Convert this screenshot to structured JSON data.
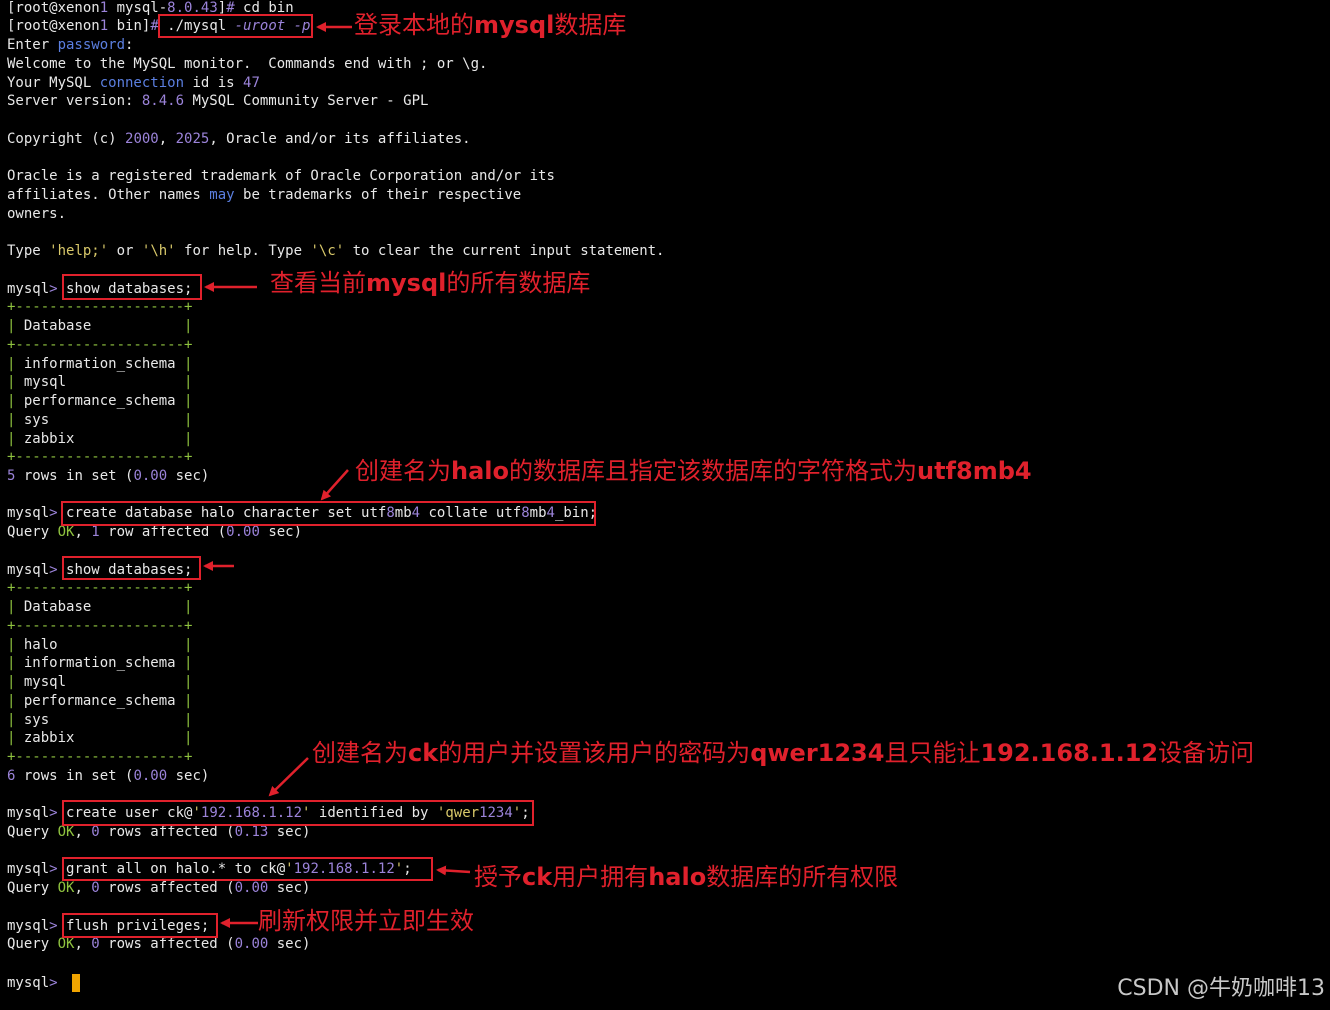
{
  "terminal": {
    "lines": [
      "[root@xenon1 mysql-8.0.43]# cd bin",
      "[root@xenon1 bin]# ./mysql -uroot -p",
      "Enter password:",
      "Welcome to the MySQL monitor.  Commands end with ; or \\g.",
      "Your MySQL connection id is 47",
      "Server version: 8.4.6 MySQL Community Server - GPL",
      "",
      "Copyright (c) 2000, 2025, Oracle and/or its affiliates.",
      "",
      "Oracle is a registered trademark of Oracle Corporation and/or its",
      "affiliates. Other names may be trademarks of their respective",
      "owners.",
      "",
      "Type 'help;' or '\\h' for help. Type '\\c' to clear the current input statement.",
      "",
      "mysql> show databases;",
      "+--------------------+",
      "| Database           |",
      "+--------------------+",
      "| information_schema |",
      "| mysql              |",
      "| performance_schema |",
      "| sys                |",
      "| zabbix             |",
      "+--------------------+",
      "5 rows in set (0.00 sec)",
      "",
      "mysql> create database halo character set utf8mb4 collate utf8mb4_bin;",
      "Query OK, 1 row affected (0.00 sec)",
      "",
      "mysql> show databases;",
      "+--------------------+",
      "| Database           |",
      "+--------------------+",
      "| halo               |",
      "| information_schema |",
      "| mysql              |",
      "| performance_schema |",
      "| sys                |",
      "| zabbix             |",
      "+--------------------+",
      "6 rows in set (0.00 sec)",
      "",
      "mysql> create user ck@'192.168.1.12' identified by 'qwer1234';",
      "Query OK, 0 rows affected (0.13 sec)",
      "",
      "mysql> grant all on halo.* to ck@'192.168.1.12';",
      "Query OK, 0 rows affected (0.00 sec)",
      "",
      "mysql> flush privileges;",
      "Query OK, 0 rows affected (0.00 sec)",
      "",
      "mysql> "
    ]
  },
  "annotations": {
    "login": "登录本地的mysql数据库",
    "show_all": "查看当前mysql的所有数据库",
    "create_db": "创建名为halo的数据库且指定该数据库的字符格式为utf8mb4",
    "create_user": "创建名为ck的用户并设置该用户的密码为qwer1234且只能让192.168.1.12设备访问",
    "grant": "授予ck用户拥有halo数据库的所有权限",
    "flush": "刷新权限并立即生效"
  },
  "watermark": "CSDN @牛奶咖啡13",
  "colors": {
    "background": "#000000",
    "annotation_red": "#e0212c",
    "cursor": "#f0a400",
    "text": "#e8e8e8"
  }
}
